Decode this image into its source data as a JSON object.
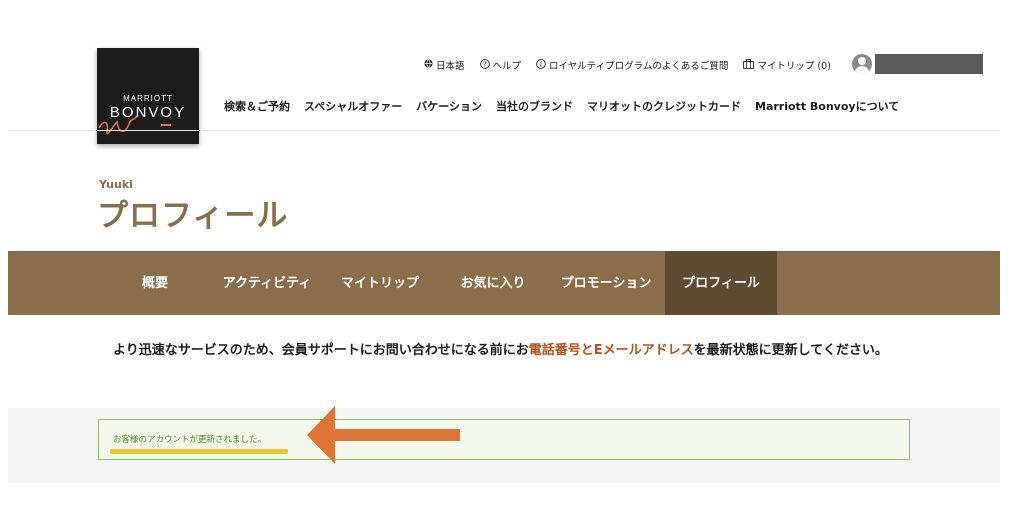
{
  "logo": {
    "line1": "MARRIOTT",
    "line2": "BONVOY"
  },
  "utility_nav": [
    {
      "icon": "globe-icon",
      "label": "日本語"
    },
    {
      "icon": "help-icon",
      "label": "ヘルプ"
    },
    {
      "icon": "info-icon",
      "label": "ロイヤルティプログラムのよくあるご質問"
    },
    {
      "icon": "briefcase-icon",
      "label": "マイトリップ (0)"
    }
  ],
  "main_nav": [
    "検索＆ご予約",
    "スペシャルオファー",
    "バケーション",
    "当社のブランド",
    "マリオットのクレジットカード",
    "Marriott Bonvoyについて"
  ],
  "profile": {
    "user_name": "Yuuki",
    "title": "プロフィール"
  },
  "tabs": [
    {
      "label": "概要"
    },
    {
      "label": "アクティビティ"
    },
    {
      "label": "マイトリップ"
    },
    {
      "label": "お気に入り"
    },
    {
      "label": "プロモーション"
    },
    {
      "label": "プロフィール",
      "active": true
    }
  ],
  "notice": {
    "before": "より迅速なサービスのため、会員サポートにお問い合わせになる前にお",
    "link": "電話番号とEメールアドレス",
    "after": "を最新状態に更新してください。"
  },
  "success_message": "お客様のアカウントが更新されました。",
  "colors": {
    "brand_brown": "#8a6e4b",
    "active_tab": "#5f4a33",
    "link_orange": "#b4521f",
    "success_green": "#4d8a1e",
    "arrow_orange": "#e07438",
    "highlight_yellow": "#f2c230"
  }
}
